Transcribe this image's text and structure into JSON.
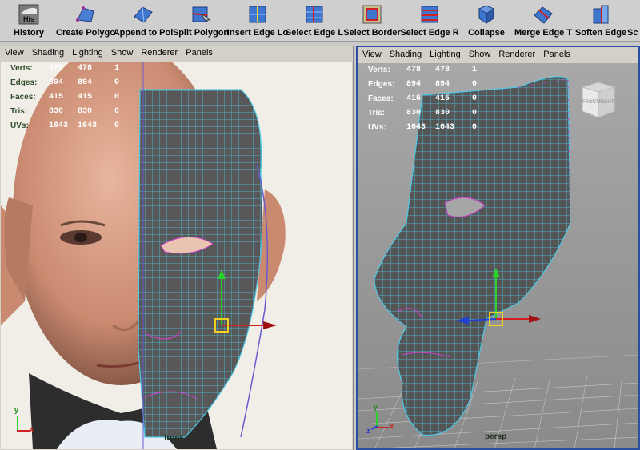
{
  "shelf": {
    "tools": [
      {
        "label": "History",
        "icon": "history-icon",
        "badge": "His"
      },
      {
        "label": "Create Polygo",
        "icon": "create-polygon-icon"
      },
      {
        "label": "Append to Pol",
        "icon": "append-polygon-icon"
      },
      {
        "label": "Split Polygon",
        "icon": "split-polygon-icon"
      },
      {
        "label": "Insert Edge Lo",
        "icon": "insert-edge-loop-icon"
      },
      {
        "label": "Select Edge L",
        "icon": "select-edge-loop-icon"
      },
      {
        "label": "Select Border",
        "icon": "select-border-icon"
      },
      {
        "label": "Select Edge R",
        "icon": "select-edge-ring-icon"
      },
      {
        "label": "Collapse",
        "icon": "collapse-icon"
      },
      {
        "label": "Merge Edge T",
        "icon": "merge-edge-icon"
      },
      {
        "label": "Soften Edge",
        "icon": "soften-edge-icon"
      },
      {
        "label": "Sc",
        "icon": "scale-icon"
      }
    ]
  },
  "panels": {
    "menu": [
      "View",
      "Shading",
      "Lighting",
      "Show",
      "Renderer",
      "Panels"
    ],
    "left": {
      "camera": "front",
      "hud": [
        {
          "key": "Verts:",
          "a": "478",
          "b": "478",
          "c": "1"
        },
        {
          "key": "Edges:",
          "a": "894",
          "b": "894",
          "c": "0"
        },
        {
          "key": "Faces:",
          "a": "415",
          "b": "415",
          "c": "0"
        },
        {
          "key": "Tris:",
          "a": "830",
          "b": "830",
          "c": "0"
        },
        {
          "key": "UVs:",
          "a": "1643",
          "b": "1643",
          "c": "0"
        }
      ],
      "axis": {
        "up": "y",
        "right": "x"
      }
    },
    "right": {
      "camera": "persp",
      "hud": [
        {
          "key": "Verts:",
          "a": "478",
          "b": "478",
          "c": "1"
        },
        {
          "key": "Edges:",
          "a": "894",
          "b": "894",
          "c": "0"
        },
        {
          "key": "Faces:",
          "a": "415",
          "b": "415",
          "c": "0"
        },
        {
          "key": "Tris:",
          "a": "830",
          "b": "830",
          "c": "0"
        },
        {
          "key": "UVs:",
          "a": "1643",
          "b": "1643",
          "c": "0"
        }
      ],
      "viewcube": {
        "front": "FRONT",
        "right": "RIGHT"
      },
      "axis": {
        "up": "y",
        "right": "x",
        "depth": "z"
      }
    }
  },
  "colors": {
    "wire": "#4fc8e6",
    "mesh": "#5b5b5b",
    "selection": "#d040d0",
    "active_border": "#2b4fa3"
  }
}
